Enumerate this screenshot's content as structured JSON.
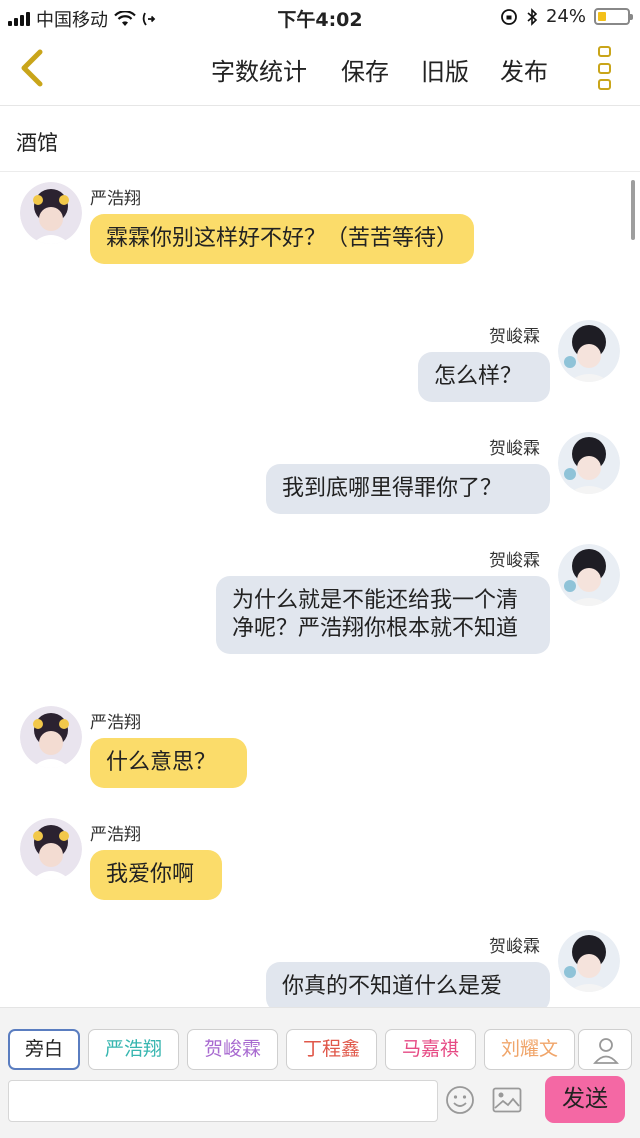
{
  "status_bar": {
    "carrier": "中国移动",
    "time": "下午4:02",
    "battery": "24%"
  },
  "toolbar": {
    "word_count": "字数统计",
    "save": "保存",
    "old_version": "旧版",
    "publish": "发布"
  },
  "chat": {
    "title": "酒馆"
  },
  "messages": [
    {
      "sender": "严浩翔",
      "side": "left",
      "text": "霖霖你别这样好不好？（苦苦等待）"
    },
    {
      "sender": "贺峻霖",
      "side": "right",
      "text": "怎么样？"
    },
    {
      "sender": "贺峻霖",
      "side": "right",
      "text": "我到底哪里得罪你了？"
    },
    {
      "sender": "贺峻霖",
      "side": "right",
      "text": "为什么就是不能还给我一个清净呢？严浩翔你根本就不知道"
    },
    {
      "sender": "严浩翔",
      "side": "left",
      "text": "什么意思？"
    },
    {
      "sender": "严浩翔",
      "side": "left",
      "text": "我爱你啊"
    },
    {
      "sender": "贺峻霖",
      "side": "right",
      "text": "你真的不知道什么是爱"
    }
  ],
  "roles": [
    {
      "label": "旁白",
      "color": "#222222"
    },
    {
      "label": "严浩翔",
      "color": "#37b6b0"
    },
    {
      "label": "贺峻霖",
      "color": "#a86ad0"
    },
    {
      "label": "丁程鑫",
      "color": "#e0584a"
    },
    {
      "label": "马嘉祺",
      "color": "#e64a84"
    },
    {
      "label": "刘耀文",
      "color": "#f0a56a"
    }
  ],
  "composer": {
    "placeholder": "",
    "send": "发送"
  },
  "colors": {
    "left_bubble": "#fbdc6a",
    "right_bubble": "#e1e6ee",
    "accent": "#c9a51a",
    "send_button": "#f468a4"
  }
}
